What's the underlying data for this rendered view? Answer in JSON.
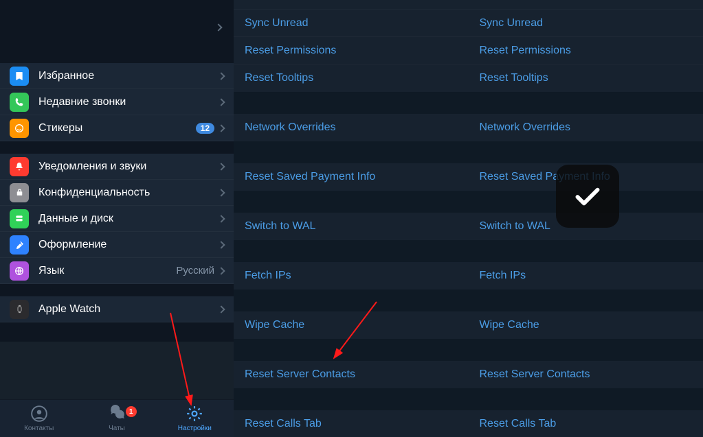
{
  "sidebar": {
    "items": [
      {
        "label": "Избранное"
      },
      {
        "label": "Недавние звонки"
      },
      {
        "label": "Стикеры",
        "badge": "12"
      },
      {
        "label": "Уведомления и звуки"
      },
      {
        "label": "Конфиденциальность"
      },
      {
        "label": "Данные и диск"
      },
      {
        "label": "Оформление"
      },
      {
        "label": "Язык",
        "value": "Русский"
      },
      {
        "label": "Apple Watch"
      }
    ]
  },
  "tabs": {
    "contacts": "Контакты",
    "chats": "Чаты",
    "chats_badge": "1",
    "settings": "Настройки"
  },
  "debug": {
    "sync_unread": "Sync Unread",
    "reset_permissions": "Reset Permissions",
    "reset_tooltips": "Reset Tooltips",
    "network_overrides": "Network Overrides",
    "reset_saved_payment": "Reset Saved Payment Info",
    "switch_to_wal": "Switch to WAL",
    "fetch_ips": "Fetch IPs",
    "wipe_cache": "Wipe Cache",
    "reset_server_contacts": "Reset Server Contacts",
    "reset_calls_tab": "Reset Calls Tab"
  }
}
